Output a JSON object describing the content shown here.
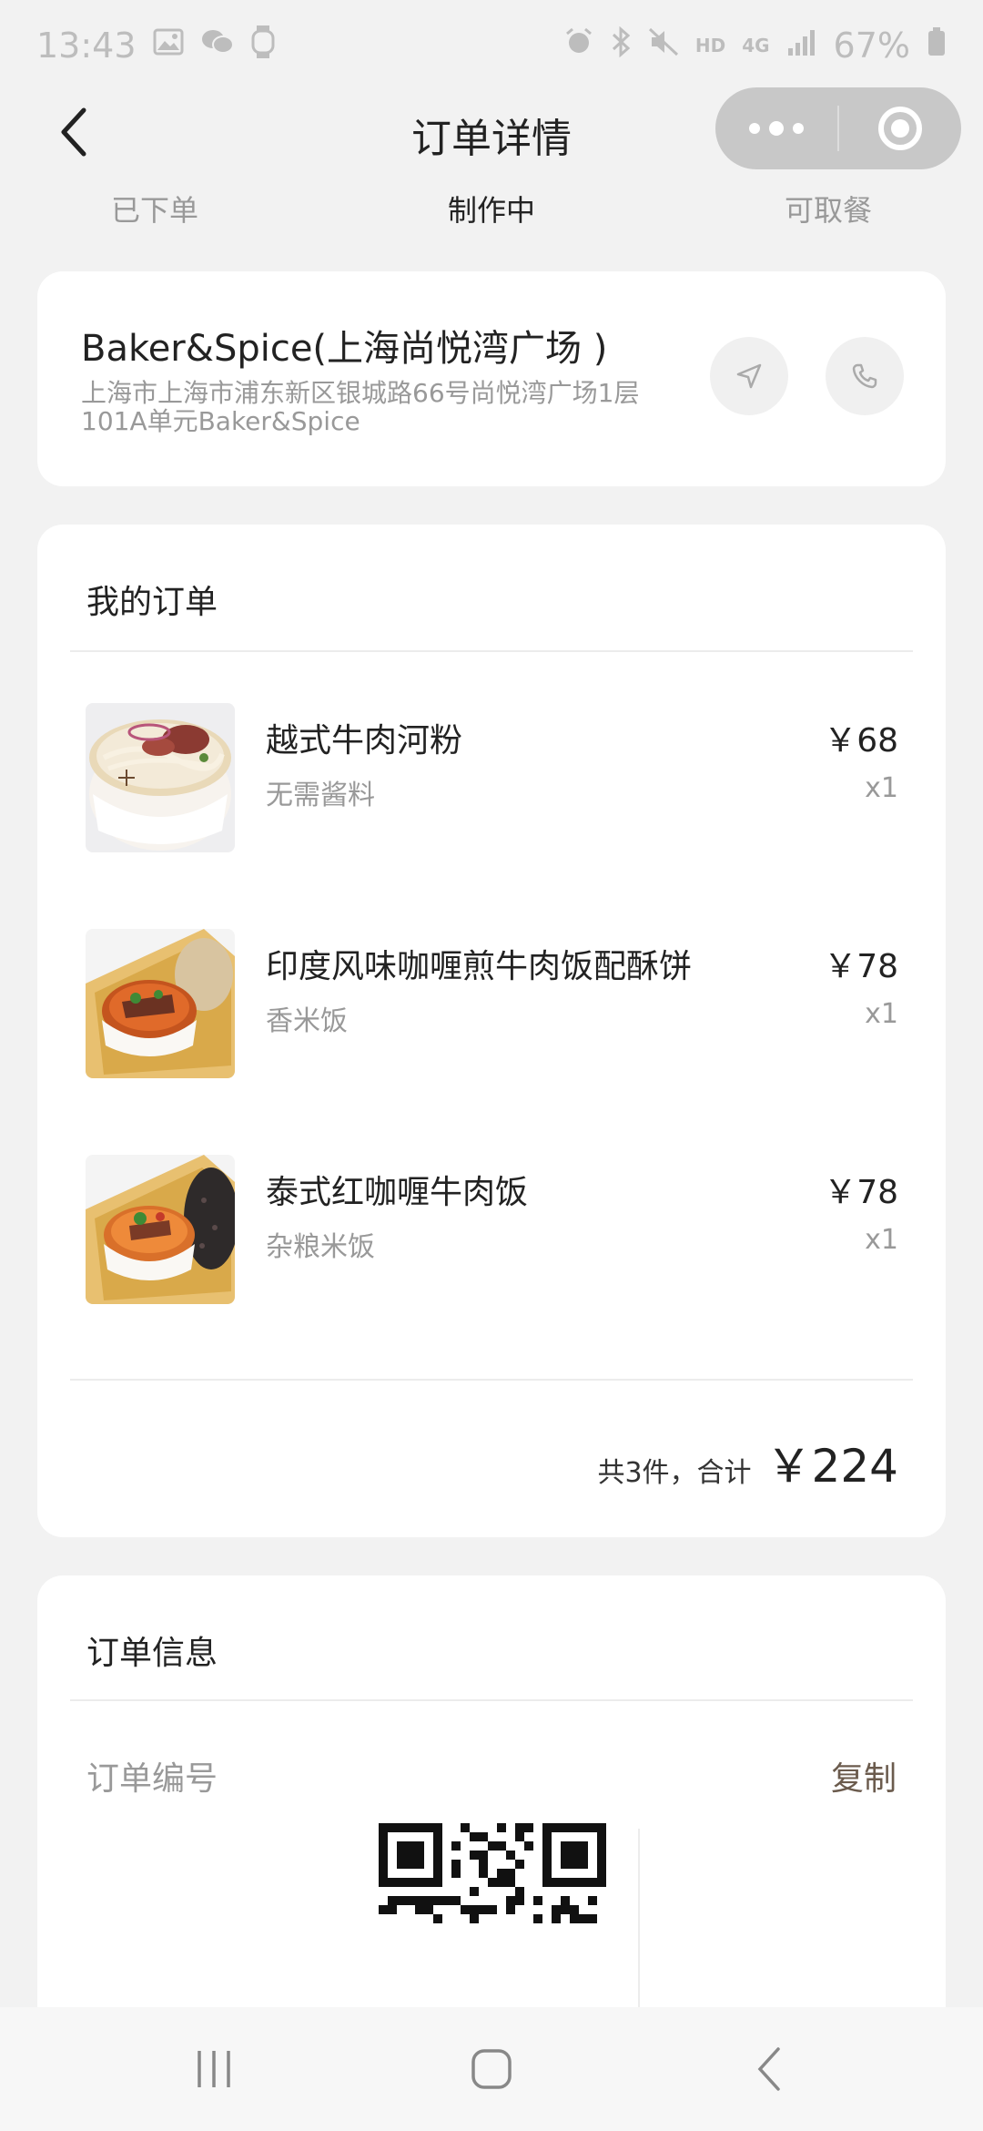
{
  "status_bar": {
    "time": "13:43",
    "battery": "67%",
    "network": "4G",
    "hd": "HD"
  },
  "nav": {
    "title": "订单详情"
  },
  "steps": [
    "已下单",
    "制作中",
    "可取餐"
  ],
  "active_step": "制作中",
  "store": {
    "name": "Baker&Spice(上海尚悦湾广场 )",
    "address_line1": "上海市上海市浦东新区银城路66号尚悦湾广场1层",
    "address_line2": "101A单元Baker&Spice"
  },
  "order": {
    "title": "我的订单",
    "items": [
      {
        "name": "越式牛肉河粉",
        "option": "无需酱料",
        "price": "￥68",
        "qty": "x1"
      },
      {
        "name": "印度风味咖喱煎牛肉饭配酥饼",
        "option": "香米饭",
        "price": "￥78",
        "qty": "x1"
      },
      {
        "name": "泰式红咖喱牛肉饭",
        "option": "杂粮米饭",
        "price": "￥78",
        "qty": "x1"
      }
    ],
    "total_label": "共3件，合计",
    "total_value": "￥224"
  },
  "info": {
    "title": "订单信息",
    "order_no_label": "订单编号",
    "copy_label": "复制"
  },
  "colors": {
    "page_bg": "#f2f2f2",
    "card_bg": "#ffffff",
    "copy_accent": "#6b5b4d",
    "muted": "#999999"
  }
}
